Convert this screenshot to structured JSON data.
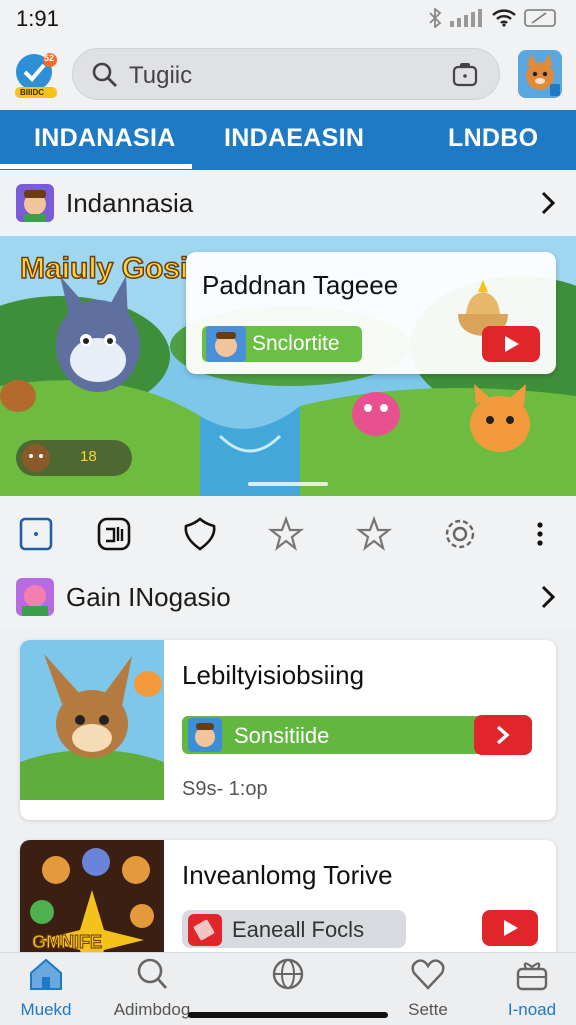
{
  "status": {
    "time": "1:91"
  },
  "app": {
    "logo_badge": "52",
    "logo_text": "BIIIDC"
  },
  "search": {
    "query": "Tugiic"
  },
  "tabs": [
    {
      "label": "INDANASIA",
      "active": true
    },
    {
      "label": "INDAEASIN",
      "active": false
    },
    {
      "label": "LNDBO",
      "active": false
    }
  ],
  "section1": {
    "title": "Indannasia"
  },
  "banner": {
    "logo": "Maiuly Gosi",
    "card_title": "Paddnan Tageee",
    "card_pill": "Snclortite",
    "badge_text": "18"
  },
  "icon_row": [
    "square-icon",
    "grid-icon",
    "shield-icon",
    "star-icon",
    "star-outline-icon",
    "gear-icon",
    "more-icon"
  ],
  "section2": {
    "title": "Gain INogasio"
  },
  "cards": [
    {
      "title": "Lebiltyisiobsiing",
      "pill": "Sonsitiide",
      "meta": "S9s- 1:op"
    },
    {
      "title": "Inveanlomg Torive",
      "pill": "Eaneall Focls",
      "art_text": "GMNIFE"
    }
  ],
  "bottom_nav": [
    {
      "label": "Muekd",
      "icon": "home-icon",
      "active": true
    },
    {
      "label": "Adimbdog",
      "icon": "search-icon",
      "active": false
    },
    {
      "label": "",
      "icon": "globe-icon",
      "active": false
    },
    {
      "label": "Sette",
      "icon": "heart-icon",
      "active": false
    },
    {
      "label": "I-noad",
      "icon": "gift-icon",
      "active": false
    }
  ],
  "colors": {
    "accent": "#1e7ac4",
    "green": "#63b63f",
    "red": "#e1262b"
  }
}
